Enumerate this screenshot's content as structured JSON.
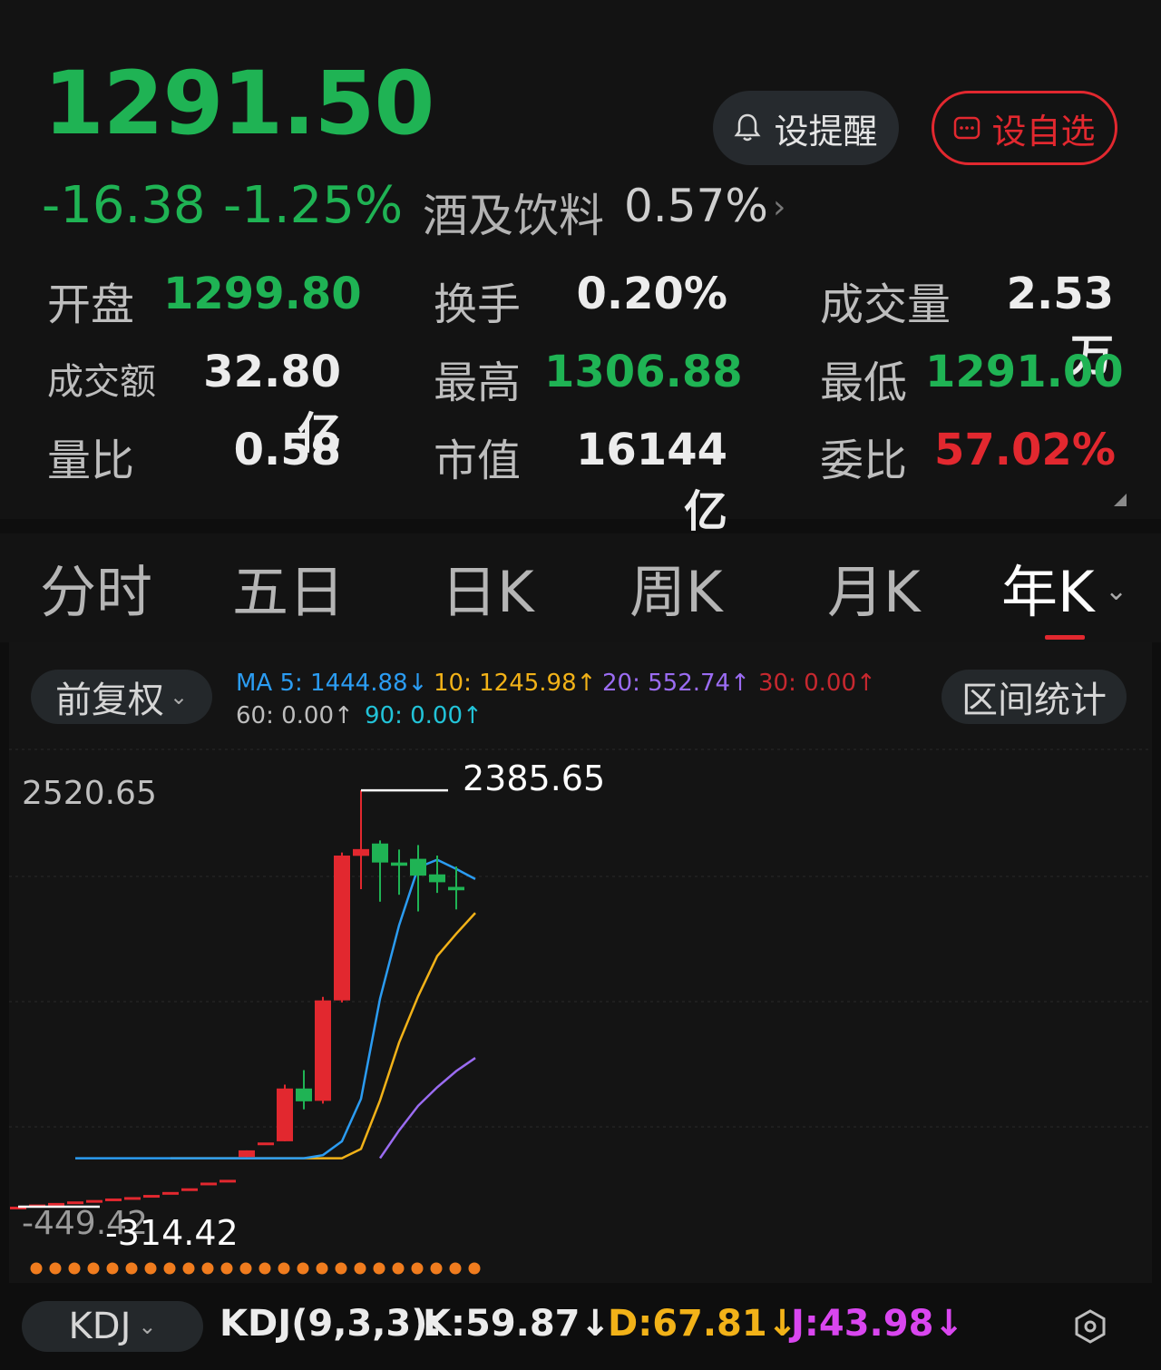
{
  "quote": {
    "price": "1291.50",
    "change": "-16.38",
    "change_pct": "-1.25%",
    "sector_name": "酒及饮料",
    "sector_pct": "0.57%"
  },
  "buttons": {
    "alert": "设提醒",
    "watchlist": "设自选"
  },
  "stats": {
    "open_label": "开盘",
    "open": "1299.80",
    "turnover_label": "换手",
    "turnover": "0.20%",
    "volume_label": "成交量",
    "volume": "2.53万",
    "amount_label": "成交额",
    "amount": "32.80亿",
    "high_label": "最高",
    "high": "1306.88",
    "low_label": "最低",
    "low": "1291.00",
    "volratio_label": "量比",
    "volratio": "0.58",
    "mktcap_label": "市值",
    "mktcap": "16144亿",
    "bidratio_label": "委比",
    "bidratio": "57.02%"
  },
  "tabs": [
    "分时",
    "五日",
    "日K",
    "周K",
    "月K",
    "年K"
  ],
  "active_tab": "年K",
  "chart_controls": {
    "adjust": "前复权",
    "range_stats": "区间统计",
    "ma5": "MA 5: 1444.88↓",
    "ma10": "10: 1245.98↑",
    "ma20": "20: 552.74↑",
    "ma30": "30: 0.00↑",
    "ma60": "60: 0.00↑",
    "ma90": "90: 0.00↑"
  },
  "colors": {
    "up": "#e2282f",
    "down": "#1fb354",
    "ma5": "#2b9cf2",
    "ma10": "#f2b218",
    "ma20": "#9b6cf2",
    "ma30": "#c7282f",
    "ma60": "#bdbdbd",
    "ma90": "#22c3d8"
  },
  "chart_data": {
    "type": "candlestick",
    "y_axis_top_label": "2520.65",
    "y_axis_bottom_label": "-449.42",
    "max_label": "2385.65",
    "min_label": "-314.42",
    "ylim": [
      -449.42,
      2520.65
    ],
    "ohlc": [
      [
        -314,
        -314,
        -314,
        -314
      ],
      [
        -300,
        -300,
        -300,
        -300
      ],
      [
        -290,
        -290,
        -290,
        -290
      ],
      [
        -280,
        -280,
        -280,
        -280
      ],
      [
        -271,
        -271,
        -271,
        -271
      ],
      [
        -261,
        -261,
        -261,
        -261
      ],
      [
        -252,
        -252,
        -252,
        -252
      ],
      [
        -238,
        -238,
        -238,
        -238
      ],
      [
        -219,
        -219,
        -219,
        -219
      ],
      [
        -195,
        -195,
        -195,
        -195
      ],
      [
        -158,
        -158,
        -158,
        -158
      ],
      [
        -140,
        -140,
        -140,
        -140
      ],
      [
        8,
        51,
        51,
        8
      ],
      [
        102,
        102,
        102,
        102
      ],
      [
        110,
        452,
        477,
        110
      ],
      [
        452,
        369,
        571,
        317
      ],
      [
        372,
        1023,
        1046,
        354
      ],
      [
        1023,
        1962,
        1982,
        1010
      ],
      [
        1960,
        2004,
        2385,
        1744
      ],
      [
        2040,
        1917,
        2060,
        1663
      ],
      [
        1917,
        1896,
        2001,
        1708
      ],
      [
        1941,
        1832,
        2030,
        1600
      ],
      [
        1840,
        1789,
        1962,
        1720
      ],
      [
        1759,
        1737,
        1891,
        1613
      ]
    ],
    "ma5": [
      [
        3,
        0
      ],
      [
        4,
        0
      ],
      [
        5,
        0
      ],
      [
        6,
        0
      ],
      [
        7,
        0
      ],
      [
        8,
        0
      ],
      [
        9,
        0
      ],
      [
        10,
        0
      ],
      [
        11,
        0
      ],
      [
        12,
        0
      ],
      [
        13,
        0
      ],
      [
        14,
        0
      ],
      [
        15,
        0
      ],
      [
        16,
        20
      ],
      [
        17,
        110
      ],
      [
        18,
        385
      ],
      [
        19,
        1035
      ],
      [
        20,
        1510
      ],
      [
        21,
        1885
      ],
      [
        22,
        1935
      ],
      [
        23,
        1875
      ],
      [
        24,
        1810
      ]
    ],
    "ma10": [
      [
        8,
        0
      ],
      [
        9,
        0
      ],
      [
        10,
        0
      ],
      [
        11,
        0
      ],
      [
        12,
        0
      ],
      [
        13,
        0
      ],
      [
        14,
        0
      ],
      [
        15,
        0
      ],
      [
        16,
        0
      ],
      [
        17,
        0
      ],
      [
        18,
        60
      ],
      [
        19,
        375
      ],
      [
        20,
        750
      ],
      [
        21,
        1050
      ],
      [
        22,
        1310
      ],
      [
        23,
        1455
      ],
      [
        24,
        1590
      ]
    ],
    "ma20": [
      [
        19,
        0
      ],
      [
        20,
        180
      ],
      [
        21,
        340
      ],
      [
        22,
        460
      ],
      [
        23,
        565
      ],
      [
        24,
        650
      ]
    ]
  },
  "kdj": {
    "selector": "KDJ",
    "title": "KDJ(9,3,3):",
    "k": "K:59.87↓",
    "d": "D:67.81↓",
    "j": "J:43.98↓"
  }
}
